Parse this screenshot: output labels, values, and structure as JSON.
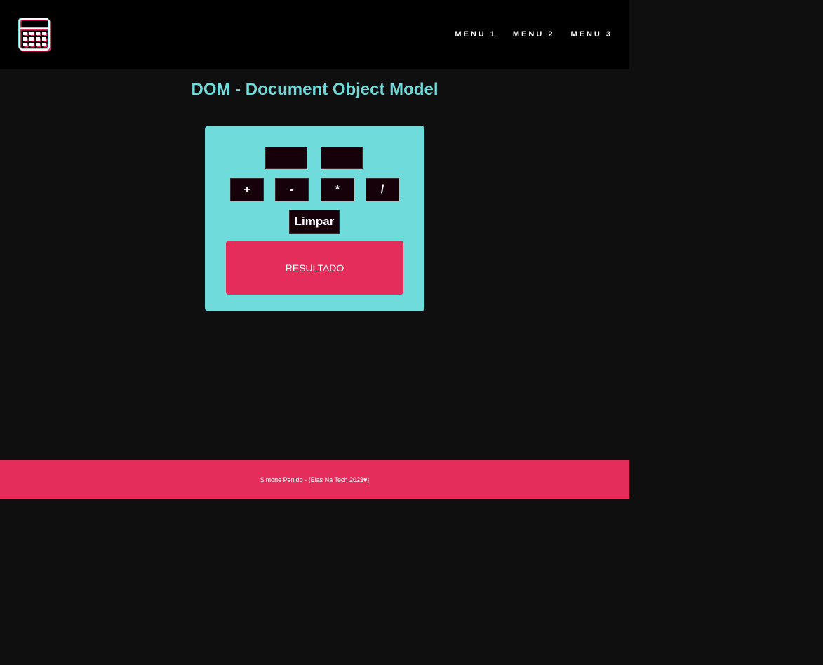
{
  "colors": {
    "accent_cyan": "#6fdcdb",
    "accent_pink": "#e42d5a",
    "header_bg": "#000000",
    "page_bg": "#0f0f0f",
    "control_bg": "#16000a"
  },
  "header": {
    "logo_icon": "calculator-icon",
    "menu": [
      {
        "label": "MENU 1"
      },
      {
        "label": "MENU 2"
      },
      {
        "label": "MENU 3"
      }
    ]
  },
  "main": {
    "title": "DOM - Document Object Model",
    "calculator": {
      "input_1_value": "",
      "input_2_value": "",
      "operations": [
        "+",
        "-",
        "*",
        "/"
      ],
      "clear_label": "Limpar",
      "result_label": "RESULTADO"
    }
  },
  "footer": {
    "text": "Simone Penido - {Elas Na Tech 2023♥}"
  }
}
